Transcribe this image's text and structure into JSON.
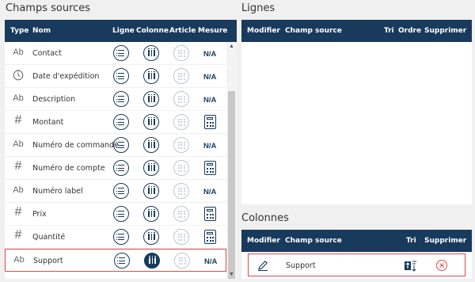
{
  "champs_sources": {
    "title": "Champs sources",
    "headers": {
      "type": "Type",
      "nom": "Nom",
      "ligne": "Ligne",
      "colonne": "Colonne",
      "article": "Article",
      "mesure": "Mesure"
    },
    "rows": [
      {
        "type": "Ab",
        "name": "Contact",
        "measure": "N/A",
        "selected": false
      },
      {
        "type": "clock",
        "name": "Date d'expédition",
        "measure": "N/A",
        "selected": false
      },
      {
        "type": "Ab",
        "name": "Description",
        "measure": "N/A",
        "selected": false
      },
      {
        "type": "#",
        "name": "Montant",
        "measure": "calculator",
        "selected": false
      },
      {
        "type": "Ab",
        "name": "Numéro de commande",
        "measure": "N/A",
        "selected": false
      },
      {
        "type": "#",
        "name": "Numéro de compte",
        "measure": "calculator",
        "selected": false
      },
      {
        "type": "Ab",
        "name": "Numéro label",
        "measure": "N/A",
        "selected": false
      },
      {
        "type": "#",
        "name": "Prix",
        "measure": "calculator",
        "selected": false
      },
      {
        "type": "#",
        "name": "Quantité",
        "measure": "calculator",
        "selected": false
      },
      {
        "type": "Ab",
        "name": "Support",
        "measure": "N/A",
        "selected": true
      }
    ]
  },
  "lignes": {
    "title": "Lignes",
    "headers": {
      "modifier": "Modifier",
      "champ": "Champ source",
      "tri": "Tri",
      "ordre": "Ordre",
      "supprimer": "Supprimer"
    }
  },
  "colonnes": {
    "title": "Colonnes",
    "headers": {
      "modifier": "Modifier",
      "champ": "Champ source",
      "tri": "Tri",
      "supprimer": "Supprimer"
    },
    "rows": [
      {
        "name": "Support"
      }
    ]
  },
  "colors": {
    "header": "#183a5c",
    "selection": "#e2494a"
  }
}
